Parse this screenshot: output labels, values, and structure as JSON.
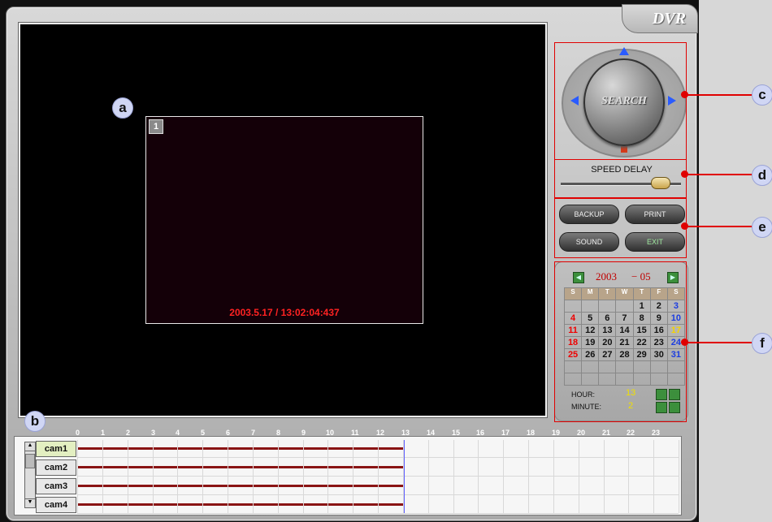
{
  "app": {
    "logo": "DVR"
  },
  "video": {
    "camera_number": "1",
    "timestamp": "2003.5.17 / 13:02:04:437"
  },
  "callouts": {
    "a": "a",
    "b": "b",
    "c": "c",
    "d": "d",
    "e": "e",
    "f": "f"
  },
  "search": {
    "label": "SEARCH"
  },
  "speed": {
    "label": "SPEED DELAY",
    "level": 0.88
  },
  "buttons": {
    "backup": "BACKUP",
    "print": "PRINT",
    "sound": "SOUND",
    "exit": "EXIT"
  },
  "calendar": {
    "year": "2003",
    "month": "− 05",
    "days_of_week": [
      "S",
      "M",
      "T",
      "W",
      "T",
      "F",
      "S"
    ],
    "weeks": [
      [
        "",
        "",
        "",
        "",
        "1",
        "2",
        "3"
      ],
      [
        "4",
        "5",
        "6",
        "7",
        "8",
        "9",
        "10"
      ],
      [
        "11",
        "12",
        "13",
        "14",
        "15",
        "16",
        "17"
      ],
      [
        "18",
        "19",
        "20",
        "21",
        "22",
        "23",
        "24"
      ],
      [
        "25",
        "26",
        "27",
        "28",
        "29",
        "30",
        "31"
      ],
      [
        "",
        "",
        "",
        "",
        "",
        "",
        ""
      ],
      [
        "",
        "",
        "",
        "",
        "",
        "",
        ""
      ]
    ],
    "selected_day": "17",
    "hour_label": "HOUR:",
    "hour_value": "13",
    "minute_label": "MINUTE:",
    "minute_value": "2"
  },
  "timeline": {
    "hours": [
      "0",
      "1",
      "2",
      "3",
      "4",
      "5",
      "6",
      "7",
      "8",
      "9",
      "10",
      "11",
      "12",
      "13",
      "14",
      "15",
      "16",
      "17",
      "18",
      "19",
      "20",
      "21",
      "22",
      "23"
    ],
    "cameras": [
      "cam1",
      "cam2",
      "cam3",
      "cam4"
    ],
    "recorded_until_hour": 13.03,
    "colors": {
      "recording": "#8a1414",
      "cursor": "#6060ff"
    }
  }
}
